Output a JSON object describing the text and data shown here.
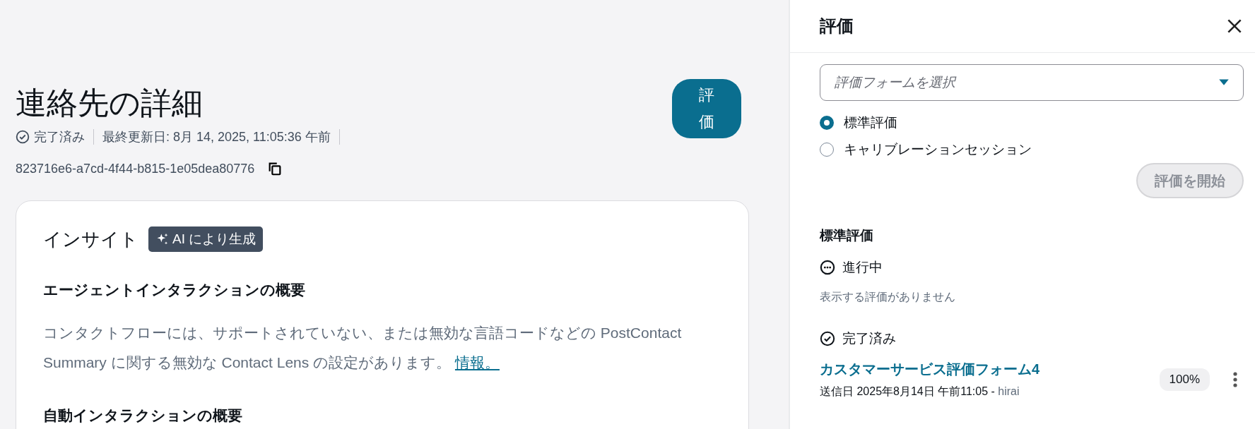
{
  "contact": {
    "title": "連絡先の詳細",
    "status": "完了済み",
    "last_updated": "最終更新日: 8月 14, 2025, 11:05:36 午前",
    "contact_id": "823716e6-a7cd-4f44-b815-1e05dea80776",
    "evaluate_button": "評価"
  },
  "insights": {
    "title": "インサイト",
    "badge": "AI により生成",
    "sections": [
      {
        "heading": "エージェントインタラクションの概要",
        "text": "コンタクトフローには、サポートされていない、または無効な言語コードなどの PostContact Summary に関する無効な Contact Lens の設定があります。",
        "link": "情報。"
      },
      {
        "heading": "自動インタラクションの概要"
      }
    ]
  },
  "panel": {
    "title": "評価",
    "form_select": {
      "placeholder": "評価フォームを選択"
    },
    "options": [
      {
        "label": "標準評価",
        "selected": true
      },
      {
        "label": "キャリブレーションセッション",
        "selected": false
      }
    ],
    "start_button": {
      "label": "評価を開始",
      "disabled": true
    },
    "section_title": "標準評価",
    "groups": [
      {
        "status": "進行中",
        "kind": "in_progress",
        "empty": "表示する評価がありません"
      },
      {
        "status": "完了済み",
        "kind": "completed",
        "items": [
          {
            "name": "カスタマーサービス評価フォーム4",
            "score": "100%",
            "meta": "送信日 2025年8月14日 午前11:05 - ",
            "user": "hirai"
          }
        ]
      }
    ]
  }
}
